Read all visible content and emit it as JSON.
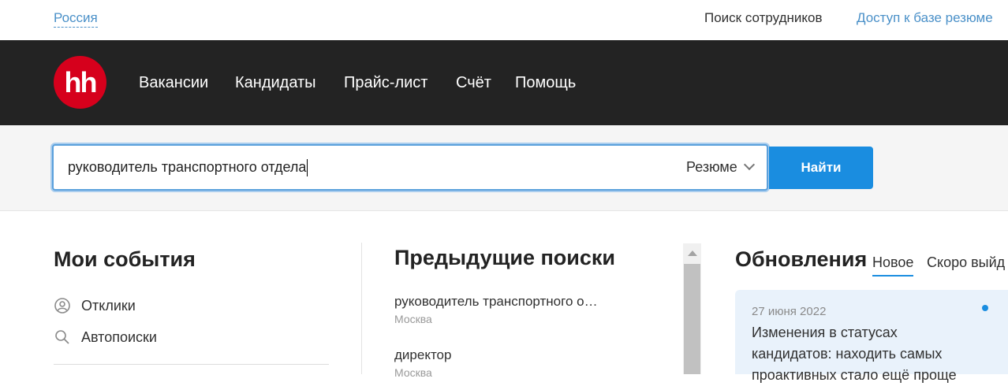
{
  "top_bar": {
    "region": "Россия",
    "employee_search": "Поиск сотрудников",
    "resume_access": "Доступ к базе резюме"
  },
  "logo": {
    "text": "hh"
  },
  "nav": {
    "items": [
      "Вакансии",
      "Кандидаты",
      "Прайс-лист",
      "Счёт",
      "Помощь"
    ]
  },
  "search": {
    "value": "руководитель транспортного отдела",
    "type": "Резюме",
    "button": "Найти"
  },
  "events": {
    "title": "Мои события",
    "items": [
      {
        "label": "Отклики",
        "icon": "person-circle-icon"
      },
      {
        "label": "Автопоиски",
        "icon": "search-icon"
      }
    ]
  },
  "previous_searches": {
    "title": "Предыдущие поиски",
    "items": [
      {
        "query": "руководитель транспортного о…",
        "city": "Москва"
      },
      {
        "query": "директор",
        "city": "Москва"
      }
    ]
  },
  "updates": {
    "title": "Обновления",
    "tabs": [
      "Новое",
      "Скоро выйд"
    ],
    "card": {
      "date": "27 июня 2022",
      "text": "Изменения в статусах кандидатов: находить самых проактивных стало ещё проще"
    }
  },
  "colors": {
    "brand_red": "#d6001c",
    "nav_bg": "#232323",
    "accent_blue": "#1a8de0",
    "link_blue": "#4a90c8",
    "card_bg": "#e9f2fb"
  }
}
